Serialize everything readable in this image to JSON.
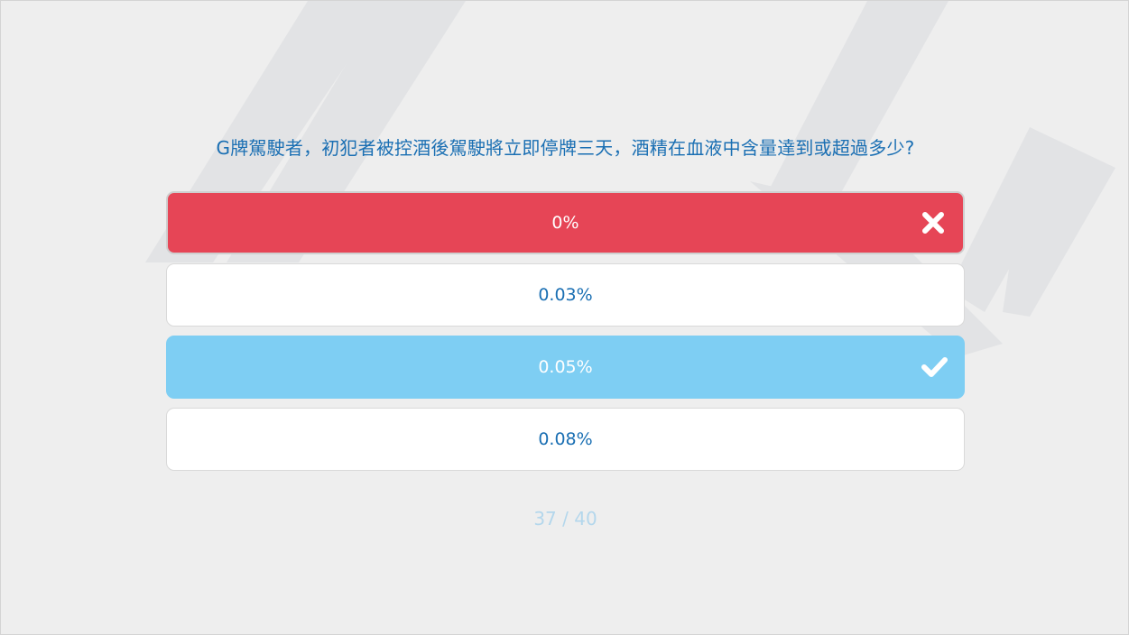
{
  "question": {
    "text": "G牌駕駛者，初犯者被控酒後駕駛將立即停牌三天，酒精在血液中含量達到或超過多少?"
  },
  "options": [
    {
      "label": "0%",
      "state": "wrong",
      "icon": "x-icon"
    },
    {
      "label": "0.03%",
      "state": "default"
    },
    {
      "label": "0.05%",
      "state": "correct",
      "icon": "checkmark-icon"
    },
    {
      "label": "0.08%",
      "state": "default"
    }
  ],
  "progress": {
    "text": "37 / 40",
    "current": 37,
    "total": 40
  },
  "colors": {
    "background": "#eeeeee",
    "question_text": "#1a6fb3",
    "wrong": "#e64556",
    "correct": "#7ecef3",
    "option_bg": "#ffffff",
    "progress_text": "#b4d7ec"
  }
}
